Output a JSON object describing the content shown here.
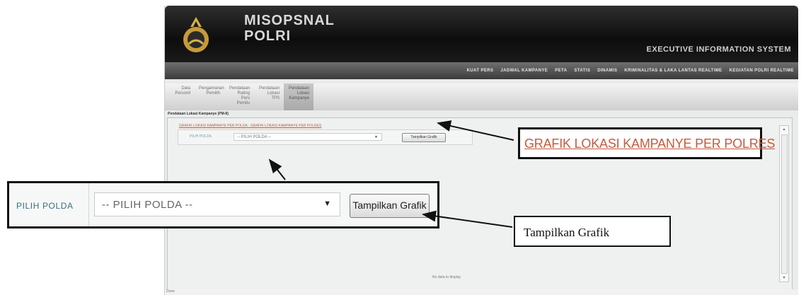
{
  "app": {
    "title_line1": "MISOPSNAL",
    "title_line2": "POLRI",
    "tagline": "EXECUTIVE INFORMATION SYSTEM",
    "nav": [
      "KUAT PERS",
      "JADWAL KAMPANYE",
      "PETA",
      "STATIS",
      "DINAMIS",
      "KRIMINALITAS & LAKA LANTAS REALTIME",
      "KEGIATAN POLRI REALTIME"
    ],
    "subtabs": [
      {
        "label": "Data Personil"
      },
      {
        "label": "Pengamanan Pemilih"
      },
      {
        "label": "Pendataan Rating Pers Pemilu"
      },
      {
        "label": "Pendataan Lokasi TPS"
      },
      {
        "label": "Pendataan Lokasi Kampanye"
      }
    ],
    "section_title": "Pendataan Lokasi Kampanye (PM-8)",
    "breadcrumb": "GRAFIK LOKASI KAMPANYE PER POLDA - GRAFIK LOKASI KAMPANYE PER POLRES",
    "filter_label": "PILIH POLDA",
    "filter_value": "-- PILIH POLDA --",
    "show_button": "Tampilkan Grafik",
    "no_data": "No data to display",
    "status": "Done"
  },
  "callouts": {
    "link_text": "GRAFIK LOKASI KAMPANYE PER POLRES",
    "button_text": "Tampilkan Grafik",
    "zoom_label": "PILIH POLDA",
    "zoom_select": "-- PILIH POLDA --",
    "zoom_button": "Tampilkan Grafik"
  },
  "colors": {
    "link": "#c65a3c",
    "label": "#3d6c7f",
    "header": "#111111"
  }
}
